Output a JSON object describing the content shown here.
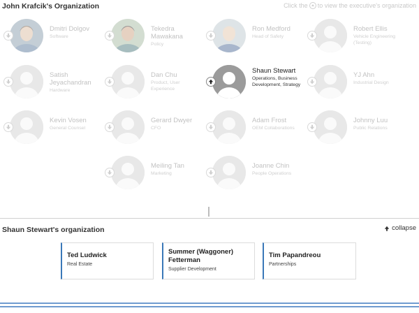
{
  "header": {
    "title": "John Krafcik's Organization",
    "hint_prefix": "Click the",
    "hint_suffix": "to view the executive's organization",
    "hint_icon": "up-arrow-circle-icon"
  },
  "people": [
    {
      "name": "Dmitri Dolgov",
      "role": "Software",
      "photo": "real",
      "active": false
    },
    {
      "name": "Tekedra Mawakana",
      "role": "Policy",
      "photo": "real",
      "active": false
    },
    {
      "name": "Ron Medford",
      "role": "Head of Safety",
      "photo": "real",
      "active": false
    },
    {
      "name": "Robert Ellis",
      "role": "Vehicle Engineering (Testing)",
      "photo": "placeholder",
      "active": false
    },
    {
      "name": "Satish Jeyachandran",
      "role": "Hardware",
      "photo": "placeholder",
      "active": false
    },
    {
      "name": "Dan Chu",
      "role": "Product, User Experience",
      "photo": "placeholder",
      "active": false
    },
    {
      "name": "Shaun Stewart",
      "role": "Operations, Business Development, Strategy",
      "photo": "placeholder",
      "active": true
    },
    {
      "name": "YJ Ahn",
      "role": "Industrial Design",
      "photo": "placeholder",
      "active": false
    },
    {
      "name": "Kevin Vosen",
      "role": "General Counsel",
      "photo": "placeholder",
      "active": false
    },
    {
      "name": "Gerard Dwyer",
      "role": "CFO",
      "photo": "placeholder",
      "active": false
    },
    {
      "name": "Adam Frost",
      "role": "OEM Collaborations",
      "photo": "placeholder",
      "active": false
    },
    {
      "name": "Johnny Luu",
      "role": "Public Relations",
      "photo": "placeholder",
      "active": false
    },
    {
      "name": "Meiling Tan",
      "role": "Marketing",
      "photo": "placeholder",
      "active": false
    },
    {
      "name": "Joanne Chin",
      "role": "People Operations",
      "photo": "placeholder",
      "active": false
    }
  ],
  "sub_org": {
    "title": "Shaun Stewart's organization",
    "collapse_label": "collapse",
    "collapse_icon": "up-arrow-icon",
    "members": [
      {
        "name": "Ted Ludwick",
        "role": "Real Estate"
      },
      {
        "name": "Summer (Waggoner) Fetterman",
        "role": "Supplier Development"
      },
      {
        "name": "Tim Papandreou",
        "role": "Partnerships"
      }
    ]
  },
  "colors": {
    "accent": "#3a78b8",
    "bottom_rule": "#6f9bd0",
    "muted_text": "#c2c2c2"
  }
}
